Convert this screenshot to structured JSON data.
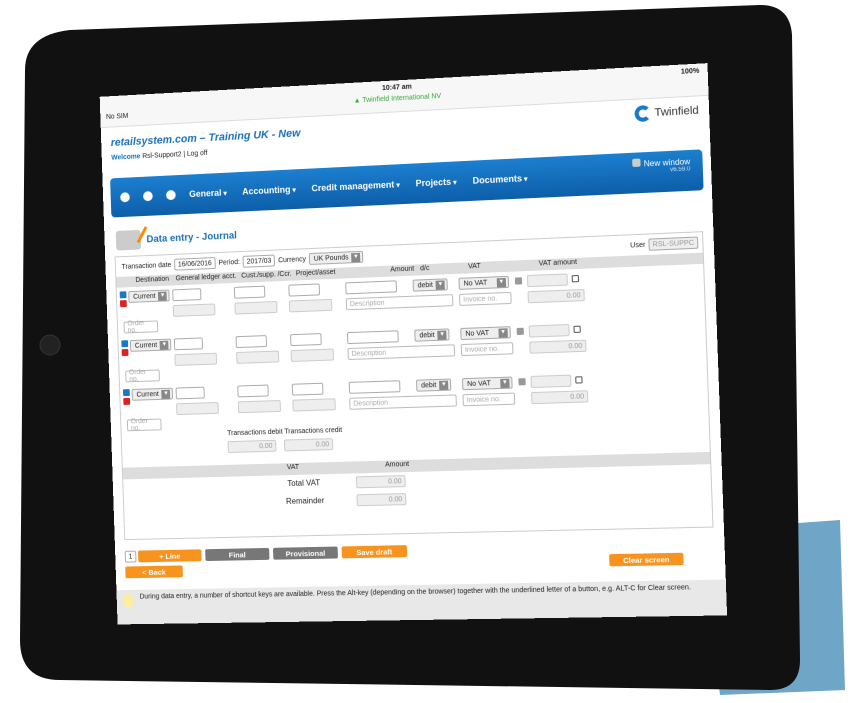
{
  "status": {
    "carrier": "No SIM",
    "time": "10:47 am",
    "site": "▲ Twinfield International NV",
    "battery": "100%"
  },
  "header": {
    "title": "retailsystem.com – Training UK - New",
    "welcome": "Welcome",
    "user": "Rsl-Support2",
    "logoff": "| Log off",
    "logo": "Twinfield"
  },
  "nav": {
    "items": [
      "General",
      "Accounting",
      "Credit management",
      "Projects",
      "Documents"
    ],
    "new_window": "New window",
    "version": "v6.59.0"
  },
  "page_title": "Data entry - Journal",
  "form": {
    "transaction_date_label": "Transaction date",
    "transaction_date": "16/06/2016",
    "period_label": "Period:",
    "period": "2017/03",
    "currency_label": "Currency",
    "currency": "UK Pounds",
    "user_label": "User",
    "user": "RSL-SUPPC",
    "columns": [
      "Destination",
      "General ledger acct.",
      "Cust./supp. /Ccr.",
      "Project/asset",
      "Amount",
      "d/c",
      "VAT",
      "VAT amount"
    ],
    "lines": [
      {
        "destination": "Current",
        "dc": "debit",
        "vat": "No VAT",
        "description": "Description",
        "invoice": "Invoice no.",
        "vat_amount": "0.00",
        "order": "Order no."
      },
      {
        "destination": "Current",
        "dc": "debit",
        "vat": "No VAT",
        "description": "Description",
        "invoice": "Invoice no.",
        "vat_amount": "0.00",
        "order": "Order no."
      },
      {
        "destination": "Current",
        "dc": "debit",
        "vat": "No VAT",
        "description": "Description",
        "invoice": "Invoice no.",
        "vat_amount": "0.00",
        "order": "Order no."
      }
    ],
    "debit_label": "Transactions debit",
    "credit_label": "Transactions credit",
    "debit": "0.00",
    "credit": "0.00",
    "vat_col": "VAT",
    "amount_col": "Amount",
    "total_vat_label": "Total VAT",
    "total_vat": "0.00",
    "remainder_label": "Remainder",
    "remainder": "0.00"
  },
  "buttons": {
    "lines": "1",
    "add_line": "+ Line",
    "final": "Final",
    "provisional": "Provisional",
    "save_draft": "Save draft",
    "back": "< Back",
    "clear": "Clear screen"
  },
  "tip": "During data entry, a number of shortcut keys are available. Press the Alt-key (depending on the browser) together with the underlined letter of a button, e.g. ALT-C for Clear screen.",
  "colors": {
    "brand": "#1a6fb8",
    "button": "#f7931e",
    "cover": "#6fa6c8"
  }
}
